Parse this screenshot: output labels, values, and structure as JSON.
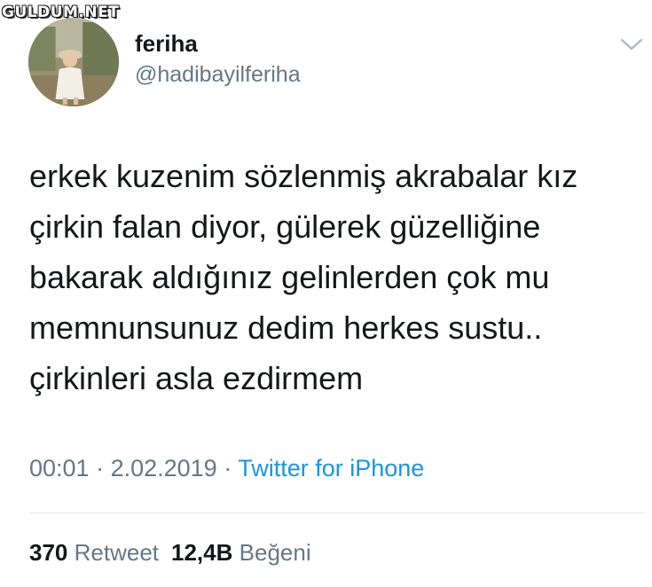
{
  "watermark": "GULDUM.NET",
  "author": {
    "name": "feriha",
    "handle": "@hadibayilferiha"
  },
  "tweet": {
    "lines": [
      "erkek kuzenim sözlenmiş akrabalar kız",
      "çirkin falan diyor, gülerek güzelliğine",
      "bakarak aldığınız gelinlerden çok mu",
      "memnunsunuz dedim herkes sustu..",
      "çirkinleri asla ezdirmem"
    ]
  },
  "meta": {
    "time": "00:01",
    "sep1": " · ",
    "date": "2.02.2019",
    "sep2": " · ",
    "source": "Twitter for iPhone"
  },
  "stats": {
    "retweet_count": "370",
    "retweet_label": "Retweet",
    "like_count": "12,4B",
    "like_label": "Beğeni"
  },
  "icons": {
    "menu": "chevron-down-icon"
  }
}
